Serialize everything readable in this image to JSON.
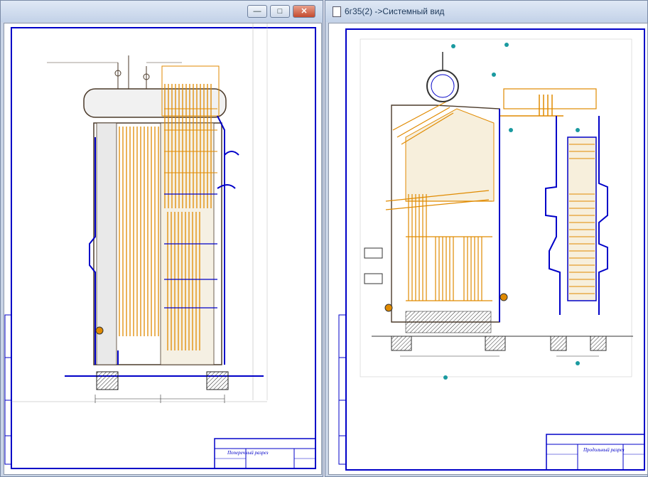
{
  "window_right": {
    "title": "6г35(2) ->Системный вид"
  },
  "window_controls": {
    "minimize": "—",
    "maximize": "□",
    "close": "✕"
  },
  "left_drawing": {
    "stamp_title": "Поперечный разрез"
  },
  "right_drawing": {
    "stamp_title": "Продольный разрез"
  },
  "colors": {
    "frame": "#0000c8",
    "pipes": "#e08a00",
    "outline": "#4b3a2a"
  }
}
